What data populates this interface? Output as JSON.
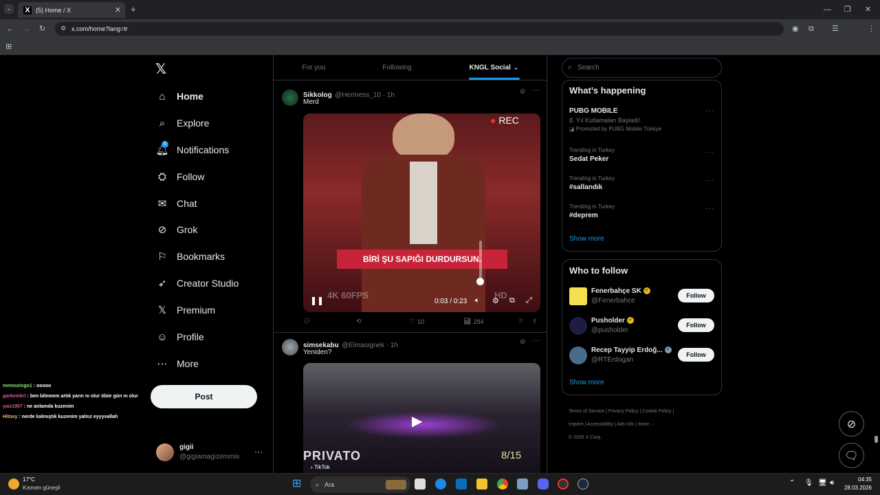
{
  "browser": {
    "tab_title": "(5) Home / X",
    "new_tab": "+",
    "url": "x.com/home?lang=tr",
    "window_min": "—",
    "window_max": "❐",
    "window_close": "✕"
  },
  "nav": {
    "items": [
      {
        "label": "Home",
        "icon": "home-icon",
        "glyph": "⌂"
      },
      {
        "label": "Explore",
        "icon": "search-icon",
        "glyph": "⌕"
      },
      {
        "label": "Notifications",
        "icon": "bell-icon",
        "glyph": "🔔︎"
      },
      {
        "label": "Follow",
        "icon": "person-plus-icon",
        "glyph": "⛭"
      },
      {
        "label": "Chat",
        "icon": "mail-icon",
        "glyph": "✉"
      },
      {
        "label": "Grok",
        "icon": "grok-icon",
        "glyph": "⊘"
      },
      {
        "label": "Bookmarks",
        "icon": "bookmark-icon",
        "glyph": "⚐"
      },
      {
        "label": "Creator Studio",
        "icon": "rocket-icon",
        "glyph": "➶"
      },
      {
        "label": "Premium",
        "icon": "x-icon",
        "glyph": "𝕏"
      },
      {
        "label": "Profile",
        "icon": "person-icon",
        "glyph": "☺"
      },
      {
        "label": "More",
        "icon": "more-circle-icon",
        "glyph": "⋯"
      }
    ],
    "notification_badge": "5",
    "post_label": "Post",
    "account": {
      "name": "gigii",
      "handle": "@gigiamagizemmis"
    }
  },
  "chat_overlay": [
    {
      "user": "memozingo1",
      "text": " : ooooo",
      "color": "#8ee37a"
    },
    {
      "user": "garkemkrl",
      "text": " : ben bilemem artık yarın nı olur öbür gün nı olur",
      "color": "#e0579b"
    },
    {
      "user": "yaiz1907",
      "text": " : ne anlamda kuzenim",
      "color": "#e0579b"
    },
    {
      "user": "Hitoxy",
      "text": " : nerde kalmıştık kuzenim yalnız eyyyvallah",
      "color": "#e9c46a"
    }
  ],
  "feed": {
    "tabs": [
      "For you",
      "Following",
      "KNGL Social"
    ],
    "tweets": [
      {
        "name": "Sikkolog",
        "handle": "@Hermess_10 · 1h",
        "text": "Merd",
        "video": {
          "caption": "BİRİ ŞU SAPIĞI DURDURSUN.",
          "rec": "REC",
          "fps": "4K 60FPS",
          "hd": "HD",
          "time": "0:03 / 0:23"
        },
        "actions": {
          "replies": "",
          "reposts": "",
          "likes": "10",
          "views": "284"
        }
      },
      {
        "name": "simsekabu",
        "handle": "@Elmasignek · 1h",
        "text": "Yeniden?",
        "video": {
          "counter": "8/15",
          "overlay": "PRIVATO",
          "source": "TikTok"
        }
      }
    ]
  },
  "right": {
    "search_placeholder": "Search",
    "whats_happening": {
      "title": "What’s happening",
      "promo": {
        "title": "PUBG MOBILE",
        "subtitle": "8. Yıl Kutlamaları Başladı!",
        "promoted": "Promoted by PUBG Mobile Türkiye"
      },
      "trends": [
        {
          "meta": "Trending in Turkey",
          "title": "Sedat Peker"
        },
        {
          "meta": "Trending in Turkey",
          "title": "#sallandık"
        },
        {
          "meta": "Trending in Turkey",
          "title": "#deprem"
        }
      ],
      "show_more": "Show more"
    },
    "who_to_follow": {
      "title": "Who to follow",
      "accounts": [
        {
          "name": "Fenerbahçe SK",
          "handle": "@Fenerbahce",
          "badge": "gold"
        },
        {
          "name": "Pusholder",
          "handle": "@pusholder",
          "badge": "gold"
        },
        {
          "name": "Recep Tayyip Erdoğ...",
          "handle": "@RTErdogan",
          "badge": "gray"
        }
      ],
      "follow_label": "Follow",
      "show_more": "Show more"
    },
    "footer": [
      "Terms of Service",
      "Privacy Policy",
      "Cookie Policy",
      "Imprint",
      "Accessibility",
      "Ads info",
      "More ···",
      "© 2026 X Corp."
    ]
  },
  "taskbar": {
    "weather_temp": "17°C",
    "weather_desc": "Kısmen güneşli",
    "search_label": "Ara",
    "time": "04:35",
    "date": "28.03.2026"
  }
}
